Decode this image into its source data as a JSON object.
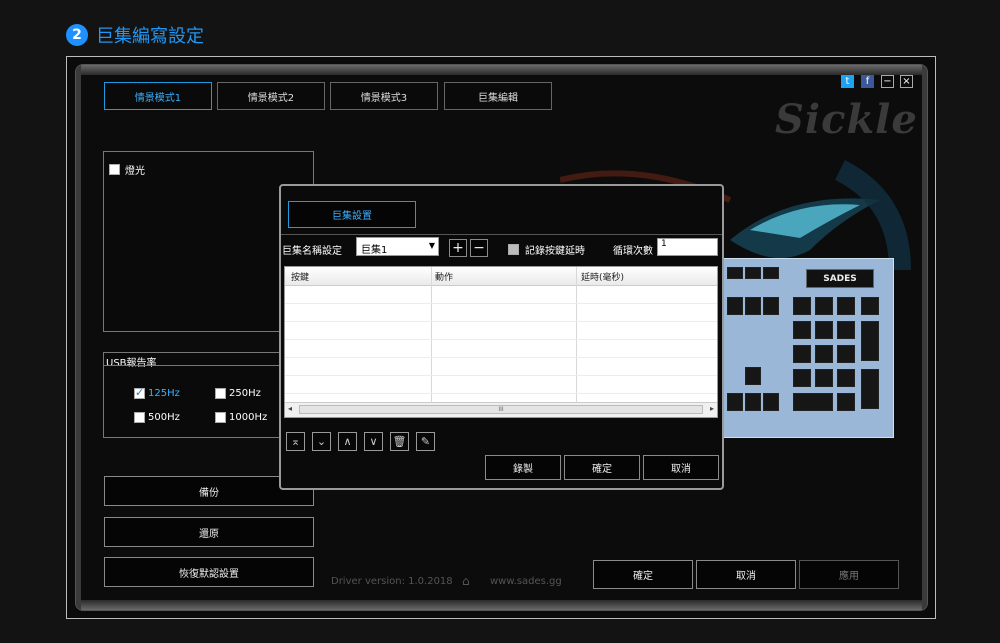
{
  "header": {
    "step": "2",
    "title": "巨集編寫設定"
  },
  "brand": {
    "logo_text": "Sickle",
    "keyboard_brand": "SADES"
  },
  "window_controls": {
    "twitter": "t",
    "facebook": "f",
    "minimize": "−",
    "close": "×"
  },
  "tabs": [
    {
      "label": "情景模式1",
      "active": true
    },
    {
      "label": "情景模式2",
      "active": false
    },
    {
      "label": "情景模式3",
      "active": false
    },
    {
      "label": "巨集編輯",
      "active": false
    }
  ],
  "lighting": {
    "label": "燈光",
    "checked": false
  },
  "usb": {
    "title": "USB報告率",
    "options": [
      {
        "label": "125Hz",
        "checked": true
      },
      {
        "label": "250Hz",
        "checked": false
      },
      {
        "label": "500Hz",
        "checked": false
      },
      {
        "label": "1000Hz",
        "checked": false
      }
    ]
  },
  "left_buttons": {
    "backup": "備份",
    "restore": "還原",
    "reset": "恢復默認設置"
  },
  "dialog": {
    "tab": "巨集設置",
    "name_label": "巨集名稱設定",
    "name_value": "巨集1",
    "add": "+",
    "remove": "−",
    "record_delay_label": "記錄按鍵延時",
    "record_delay_checked": false,
    "loop_label": "循環次數",
    "loop_value": "1",
    "columns": [
      "按鍵",
      "動作",
      "延時(毫秒)"
    ],
    "scroll_label": "III",
    "buttons": {
      "record": "錄製",
      "ok": "確定",
      "cancel": "取消"
    },
    "tool_icons": [
      "move-top-icon",
      "move-bottom-icon",
      "move-up-icon",
      "move-down-icon",
      "delete-icon",
      "clear-icon"
    ]
  },
  "footer": {
    "driver": "Driver version: 1.0.2018",
    "url": "www.sades.gg",
    "buttons": {
      "ok": "確定",
      "cancel": "取消",
      "apply": "應用"
    }
  },
  "colors": {
    "accent": "#1e9be0",
    "header_blue": "#2196f3",
    "keyboard": "#9bb7d8"
  }
}
